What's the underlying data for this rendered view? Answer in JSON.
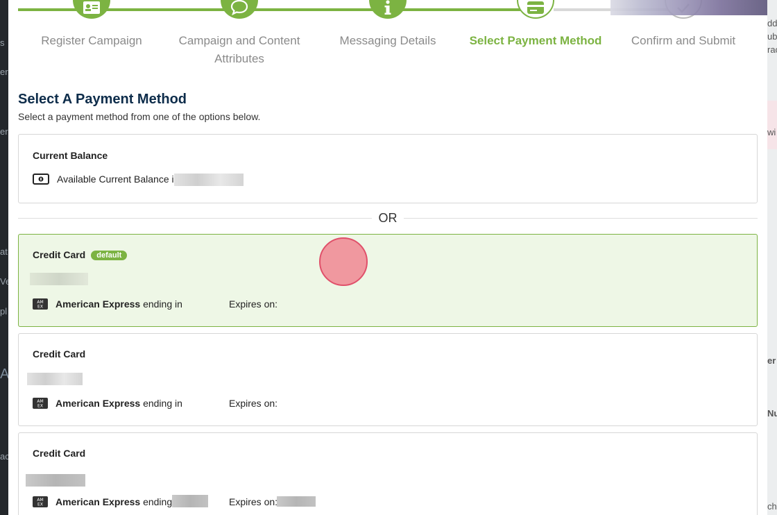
{
  "background": {
    "left_fragments": [
      "s",
      "er",
      "er",
      "at",
      "Ve",
      "pl",
      "A(",
      "ac"
    ],
    "right_fragments": [
      "dd",
      "ub",
      "rac",
      "wi",
      "er",
      "Nu",
      "ch"
    ]
  },
  "stepper": {
    "steps": [
      {
        "label": "Register Campaign",
        "icon": "id-card-icon",
        "state": "done"
      },
      {
        "label": "Campaign and Content Attributes",
        "icon": "chat-bubble-icon",
        "state": "done"
      },
      {
        "label": "Messaging Details",
        "icon": "info-icon",
        "state": "done"
      },
      {
        "label": "Select Payment Method",
        "icon": "credit-card-icon",
        "state": "active"
      },
      {
        "label": "Confirm and Submit",
        "icon": "check-icon",
        "state": "todo"
      }
    ]
  },
  "page": {
    "title": "Select A Payment Method",
    "subtitle": "Select a payment method from one of the options below."
  },
  "balance_card": {
    "title": "Current Balance",
    "text": "Available Current Balance is"
  },
  "divider": {
    "text": "OR"
  },
  "cards": [
    {
      "title": "Credit Card",
      "badge": "default",
      "brand": "American Express",
      "ending": "ending in",
      "expires": "Expires on:",
      "selected": true
    },
    {
      "title": "Credit Card",
      "badge": "",
      "brand": "American Express",
      "ending": "ending in",
      "expires": "Expires on:",
      "selected": false
    },
    {
      "title": "Credit Card",
      "badge": "",
      "brand": "American Express",
      "ending": "ending in",
      "expires": "Expires on:",
      "selected": false
    }
  ],
  "colors": {
    "accent": "#7cb342",
    "title": "#0d2c4a",
    "selected_bg": "#eef7e6"
  }
}
